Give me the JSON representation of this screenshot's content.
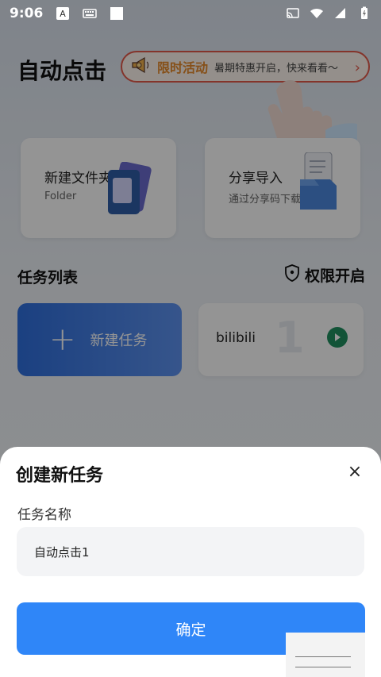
{
  "status_bar": {
    "time": "9:06"
  },
  "app": {
    "title": "自动点击"
  },
  "promo": {
    "badge": "限时活动",
    "text": "暑期特惠开启，快来看看～",
    "chevron": "›"
  },
  "cards": [
    {
      "title": "新建文件夹",
      "subtitle": "Folder"
    },
    {
      "title": "分享导入",
      "subtitle": "通过分享码下载"
    }
  ],
  "task_section": {
    "title": "任务列表",
    "permission_label": "权限开启"
  },
  "tasks": {
    "new_task_plus": "+",
    "new_task_label": "新建任务",
    "items": [
      {
        "name": "bilibili",
        "count": "1"
      }
    ]
  },
  "sheet": {
    "title": "创建新任务",
    "close_symbol": "×",
    "field_label": "任务名称",
    "input_value": "自动点击1",
    "confirm_label": "确定"
  }
}
